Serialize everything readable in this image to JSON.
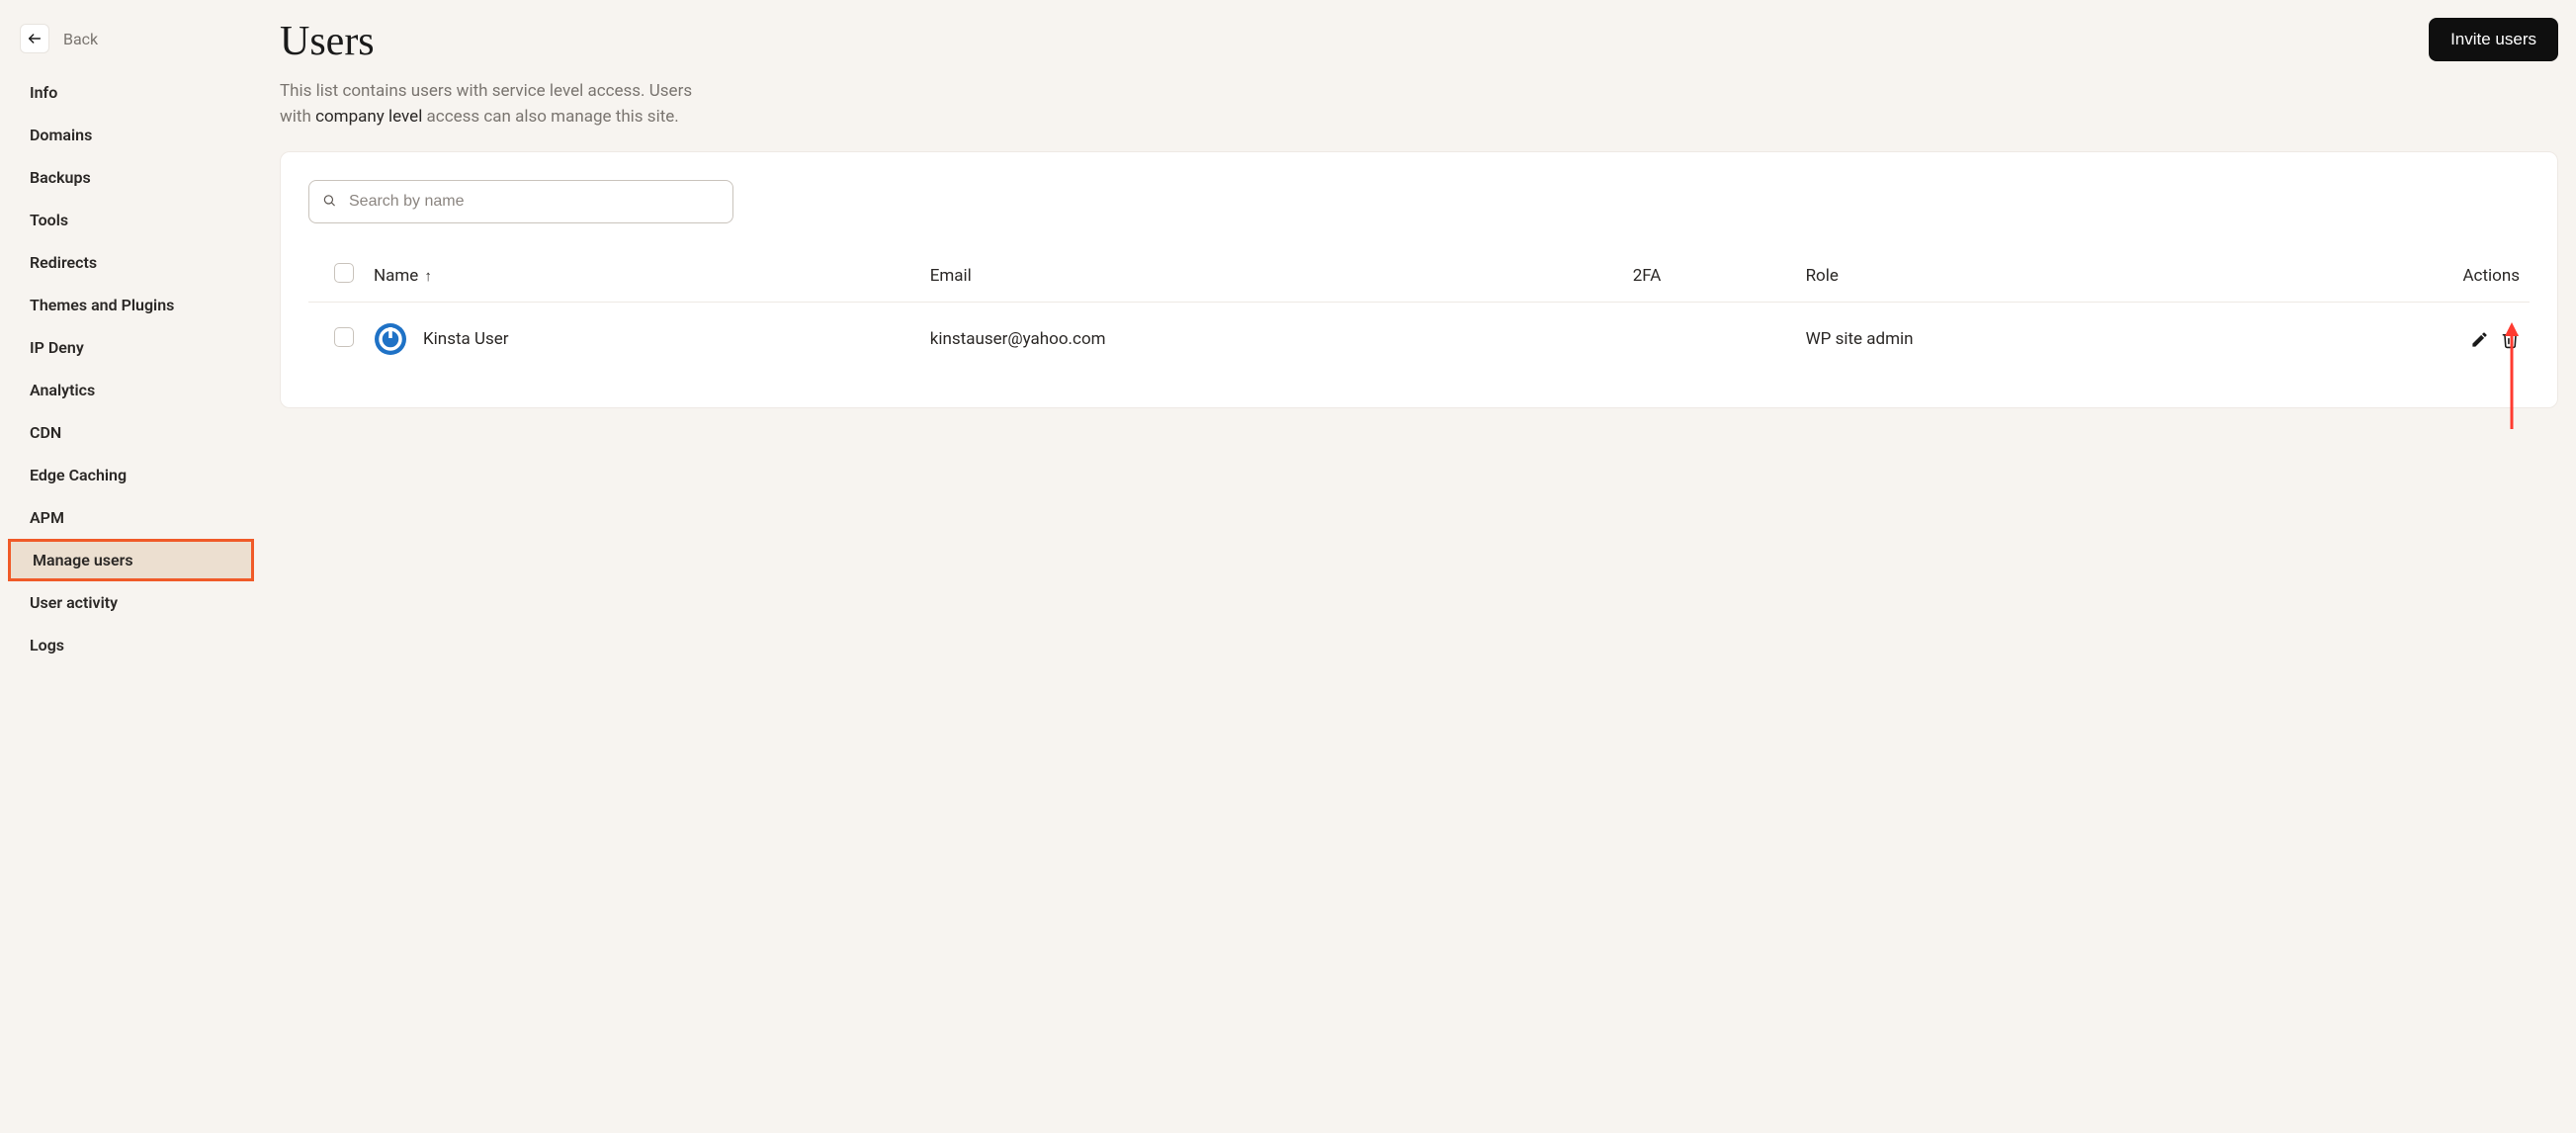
{
  "back": {
    "label": "Back"
  },
  "sidebar": {
    "items": [
      {
        "label": "Info"
      },
      {
        "label": "Domains"
      },
      {
        "label": "Backups"
      },
      {
        "label": "Tools"
      },
      {
        "label": "Redirects"
      },
      {
        "label": "Themes and Plugins"
      },
      {
        "label": "IP Deny"
      },
      {
        "label": "Analytics"
      },
      {
        "label": "CDN"
      },
      {
        "label": "Edge Caching"
      },
      {
        "label": "APM"
      },
      {
        "label": "Manage users"
      },
      {
        "label": "User activity"
      },
      {
        "label": "Logs"
      }
    ],
    "active_index": 11
  },
  "page": {
    "title": "Users",
    "subtitle_pre": "This list contains users with service level access. Users with ",
    "subtitle_link": "company level",
    "subtitle_post": " access can also manage this site.",
    "invite_button": "Invite users"
  },
  "search": {
    "placeholder": "Search by name"
  },
  "table": {
    "headers": {
      "name": "Name",
      "email": "Email",
      "twofa": "2FA",
      "role": "Role",
      "actions": "Actions"
    },
    "rows": [
      {
        "name": "Kinsta User",
        "email": "kinstauser@yahoo.com",
        "twofa": "",
        "role": "WP site admin"
      }
    ]
  }
}
